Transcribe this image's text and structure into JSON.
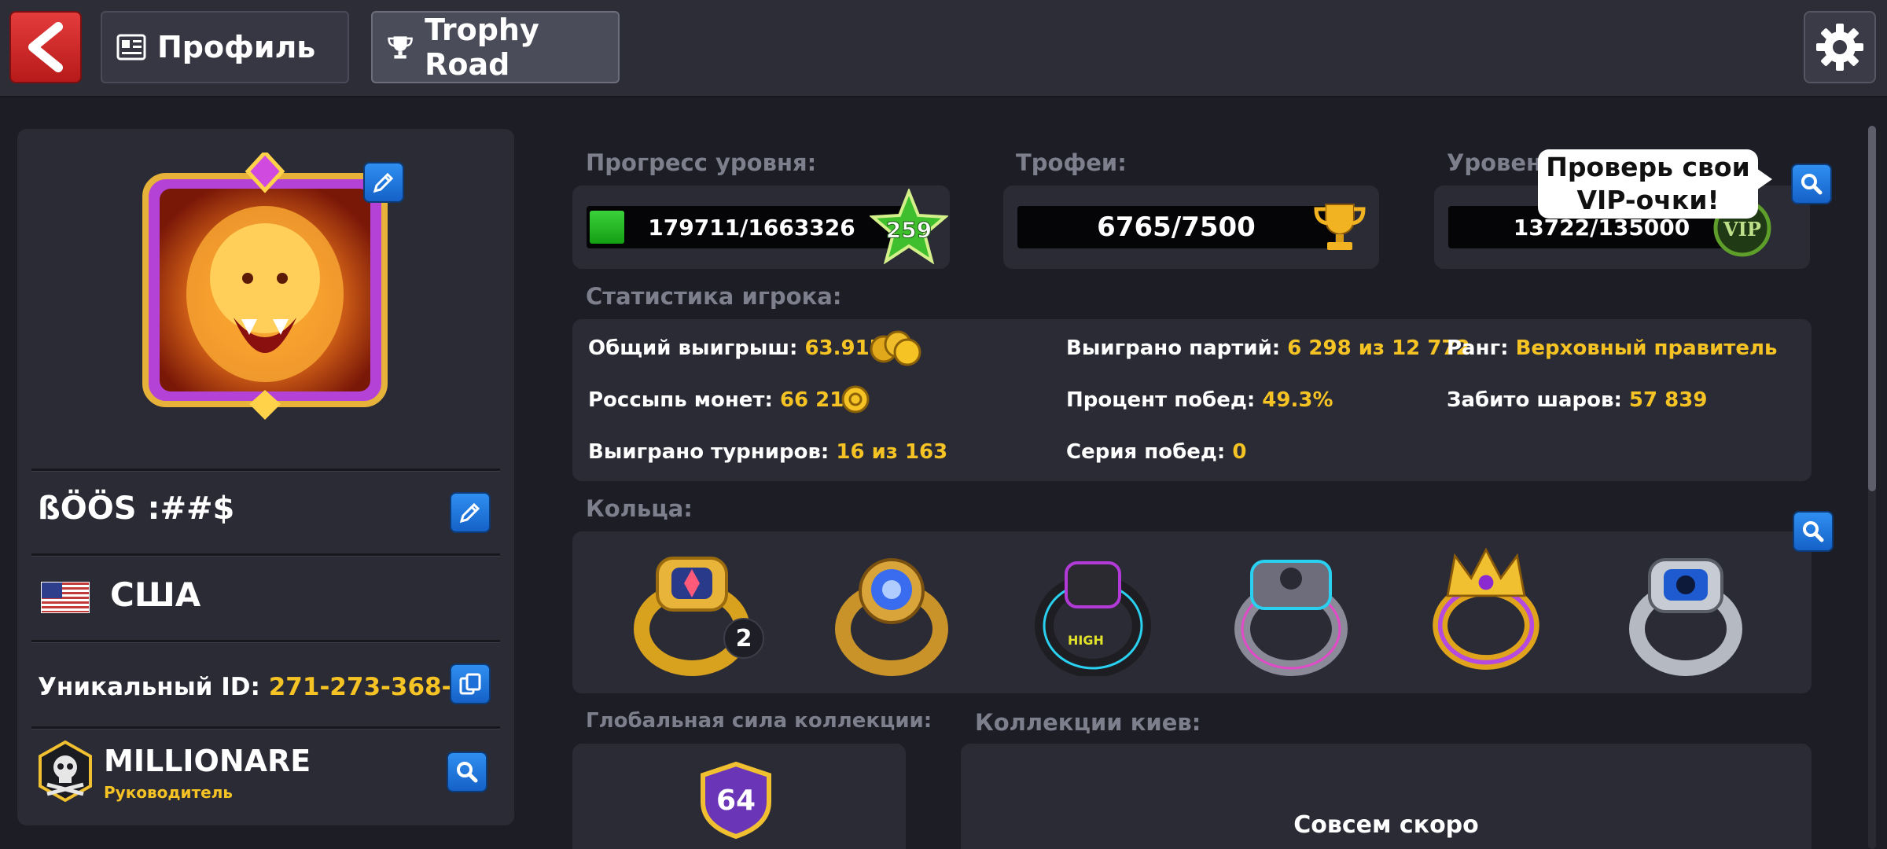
{
  "header": {
    "back_icon": "chevron-left-icon",
    "tabs": [
      {
        "label": "Профиль",
        "icon": "id-card-icon"
      },
      {
        "label": "Trophy Road",
        "icon": "trophy-icon"
      }
    ],
    "settings_icon": "gear-icon"
  },
  "left_panel": {
    "username": "ßÖÖS :##$",
    "country": "США",
    "unique_id_label": "Уникальный ID: ",
    "unique_id": "271-273-368-2",
    "club_name": "MILLIONARE",
    "club_role": "Руководитель"
  },
  "level": {
    "label": "Прогресс уровня:",
    "progress": "179711/1663326",
    "progress_fraction": 0.108,
    "level": "259"
  },
  "trophies": {
    "label": "Трофеи:",
    "value": "6765/7500"
  },
  "vip": {
    "label": "Уровен",
    "value": "13722/135000",
    "badge": "VIP",
    "tooltip_line1": "Проверь свои",
    "tooltip_line2": "VIP-очки!"
  },
  "stats": {
    "label": "Статистика игрока:",
    "rows": [
      {
        "label": "Общий выигрыш: ",
        "value": "63.91B"
      },
      {
        "label": "Выиграно партий: ",
        "value": "6 298 из 12 772"
      },
      {
        "label": "Ранг: ",
        "value": "Верховный правитель"
      },
      {
        "label": "Россыпь монет: ",
        "value": "66 211"
      },
      {
        "label": "Процент побед: ",
        "value": "49.3%"
      },
      {
        "label": "Забито шаров: ",
        "value": "57 839"
      },
      {
        "label": "Выиграно турниров: ",
        "value": "16 из 163"
      },
      {
        "label": "Серия побед: ",
        "value": "0"
      }
    ]
  },
  "rings": {
    "label": "Кольца:",
    "first_ring_count": "2"
  },
  "collection_power": {
    "label": "Глобальная сила коллекции:",
    "value": "64"
  },
  "cue_collections": {
    "label": "Коллекции киев:",
    "coming_soon": "Совсем скоро"
  },
  "colors": {
    "accent_yellow": "#f6c325",
    "panel": "#2a2b35",
    "background": "#1d1d26"
  }
}
